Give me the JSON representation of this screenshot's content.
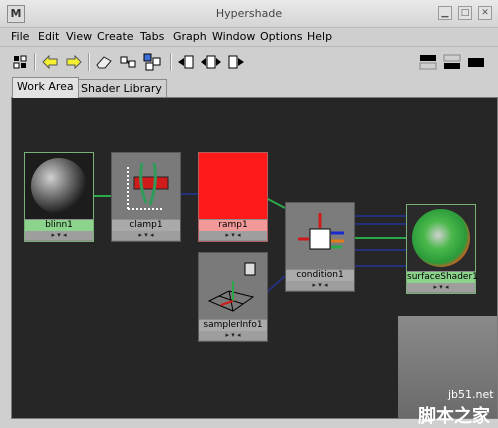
{
  "window": {
    "title": "Hypershade",
    "icon": "maya-logo-icon",
    "logo_text": "M"
  },
  "menu": [
    "File",
    "Edit",
    "View",
    "Create",
    "Tabs",
    "Graph",
    "Window",
    "Options",
    "Help"
  ],
  "toolbar": {
    "icons": [
      "clear-graph-icon",
      "back-arrow-icon",
      "forward-arrow-icon",
      "eraser-icon",
      "render-nodes-icon",
      "graph-network-icon",
      "input-connections-icon",
      "input-output-connections-icon",
      "output-connections-icon",
      "layout-top-icon",
      "layout-bottom-icon",
      "layout-single-icon"
    ]
  },
  "tabs": [
    {
      "label": "Work Area",
      "active": true
    },
    {
      "label": "Shader Library",
      "active": false
    }
  ],
  "nodes": [
    {
      "id": "blinn1",
      "label": "blinn1",
      "label_color": "#8cd48c"
    },
    {
      "id": "clamp1",
      "label": "clamp1",
      "label_color": "#aaaaaa"
    },
    {
      "id": "ramp1",
      "label": "ramp1",
      "label_color": "#f29a9a"
    },
    {
      "id": "condition1",
      "label": "condition1",
      "label_color": "#aaaaaa"
    },
    {
      "id": "samplerInfo1",
      "label": "samplerInfo1",
      "label_color": "#aaaaaa"
    },
    {
      "id": "surfaceShader1",
      "label": "surfaceShader1",
      "label_color": "#8cd48c"
    }
  ],
  "watermark": {
    "url": "jb51.net",
    "text": "脚本之家"
  }
}
